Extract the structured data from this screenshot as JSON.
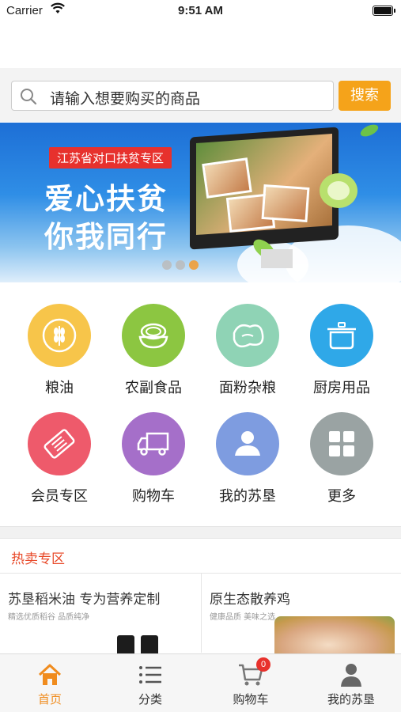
{
  "status_bar": {
    "carrier": "Carrier",
    "time": "9:51 AM"
  },
  "search": {
    "placeholder": "请输入想要购买的商品",
    "button": "搜索"
  },
  "banner": {
    "tag": "江苏省对口扶贫专区",
    "line1": "爱心扶贫",
    "line2": "你我同行",
    "page_count": 3,
    "active_page": 2
  },
  "categories": [
    {
      "label": "粮油",
      "icon": "grain-icon",
      "color": "#f7c54a"
    },
    {
      "label": "农副食品",
      "icon": "bowl-icon",
      "color": "#8cc641"
    },
    {
      "label": "面粉杂粮",
      "icon": "bean-icon",
      "color": "#8fd3b5"
    },
    {
      "label": "厨房用品",
      "icon": "pot-icon",
      "color": "#2fa8e8"
    },
    {
      "label": "会员专区",
      "icon": "ticket-icon",
      "color": "#ee5a6b"
    },
    {
      "label": "购物车",
      "icon": "truck-icon",
      "color": "#a56fc9"
    },
    {
      "label": "我的苏垦",
      "icon": "user-icon",
      "color": "#7e9ce0"
    },
    {
      "label": "更多",
      "icon": "grid-icon",
      "color": "#9aa3a3"
    }
  ],
  "hot_section": {
    "title": "热卖专区"
  },
  "products": [
    {
      "name": "苏垦稻米油  专为营养定制",
      "sub": "精选优质稻谷   品质纯净"
    },
    {
      "name": "原生态散养鸡",
      "sub": "健康品质   美味之选"
    }
  ],
  "tab_bar": {
    "tabs": [
      {
        "label": "首页",
        "icon": "home-icon"
      },
      {
        "label": "分类",
        "icon": "list-icon"
      },
      {
        "label": "购物车",
        "icon": "cart-icon"
      },
      {
        "label": "我的苏垦",
        "icon": "profile-icon"
      }
    ],
    "active": 0,
    "cart_badge": "0"
  },
  "colors": {
    "accent": "#f5a31a",
    "active_tab": "#f08c1e",
    "hot": "#e84a2a",
    "badge": "#e8312c"
  }
}
